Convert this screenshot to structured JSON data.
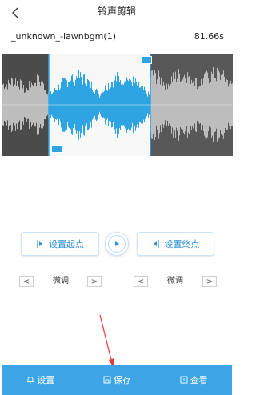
{
  "header": {
    "title": "铃声剪辑",
    "back_icon": "chevron-left-icon"
  },
  "file": {
    "name": "_unknown_-lawnbgm(1)",
    "duration": "81.66s"
  },
  "controls": {
    "set_start_label": "设置起点",
    "set_end_label": "设置终点",
    "fine_tune_start": {
      "prev": "<",
      "label": "微调",
      "next": ">"
    },
    "fine_tune_end": {
      "prev": "<",
      "label": "微调",
      "next": ">"
    }
  },
  "bottom_bar": {
    "tabs": [
      {
        "label": "设置",
        "icon": "bell-icon"
      },
      {
        "label": "保存",
        "icon": "save-icon"
      },
      {
        "label": "查看",
        "icon": "view-icon"
      }
    ]
  },
  "colors": {
    "accent": "#3da5e6",
    "wave_selected": "#2ea4e3",
    "wave_unselected": "#bdbdbd",
    "wave_bg": "#4b4b4b",
    "annotation_arrow": "#e53935"
  }
}
